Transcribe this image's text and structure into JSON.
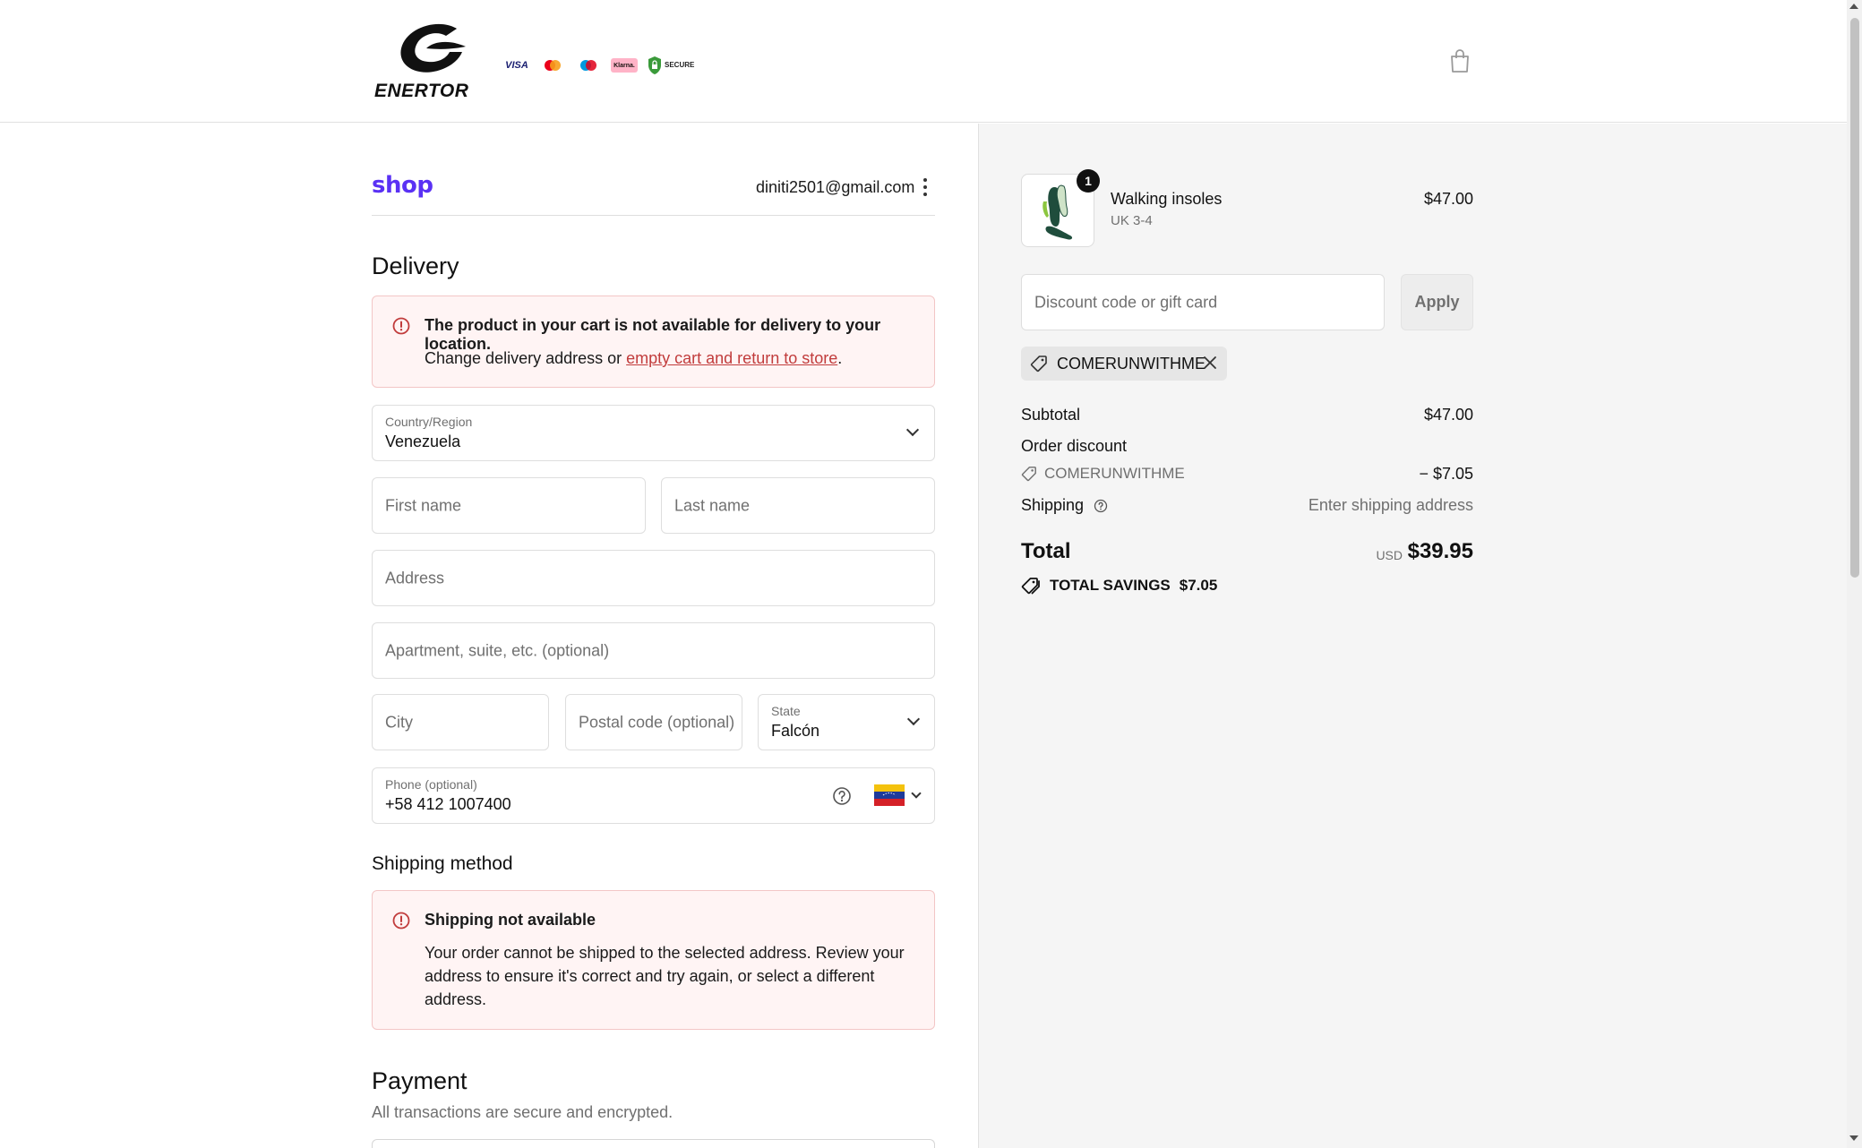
{
  "header": {
    "brand": "ENERTOR",
    "payment_badges": [
      "VISA",
      "Klarna."
    ],
    "secure_label": "SECURE"
  },
  "shop_pay": {
    "logo": "shop",
    "email": "diniti2501@gmail.com"
  },
  "delivery": {
    "heading": "Delivery",
    "error_title": "The product in your cart is not available for delivery to your location.",
    "error_text_prefix": "Change delivery address or ",
    "error_link": "empty cart and return to store",
    "error_text_suffix": ".",
    "country_label": "Country/Region",
    "country_value": "Venezuela",
    "first_name_placeholder": "First name",
    "last_name_placeholder": "Last name",
    "address_placeholder": "Address",
    "apartment_placeholder": "Apartment, suite, etc. (optional)",
    "city_placeholder": "City",
    "postal_placeholder": "Postal code (optional)",
    "state_label": "State",
    "state_value": "Falcón",
    "phone_label": "Phone (optional)",
    "phone_value": "+58 412 1007400"
  },
  "shipping": {
    "heading": "Shipping method",
    "error_title": "Shipping not available",
    "error_text": "Your order cannot be shipped to the selected address. Review your address to ensure it's correct and try again, or select a different address."
  },
  "payment": {
    "heading": "Payment",
    "subtext": "All transactions are secure and encrypted."
  },
  "summary": {
    "item": {
      "quantity": "1",
      "name": "Walking insoles",
      "variant": "UK 3-4",
      "price": "$47.00"
    },
    "discount_placeholder": "Discount code or gift card",
    "apply_label": "Apply",
    "applied_code": "COMERUNWITHME",
    "subtotal_label": "Subtotal",
    "subtotal_value": "$47.00",
    "order_discount_label": "Order discount",
    "discount_code": "COMERUNWITHME",
    "discount_value": "− $7.05",
    "shipping_label": "Shipping",
    "shipping_value": "Enter shipping address",
    "total_label": "Total",
    "total_currency": "USD",
    "total_value": "$39.95",
    "savings_label": "TOTAL SAVINGS",
    "savings_value": "$7.05"
  },
  "colors": {
    "shop_brand": "#5a31f4",
    "error": "#c13c3c",
    "error_bg": "#fff4f4",
    "summary_bg": "#f5f5f5"
  }
}
